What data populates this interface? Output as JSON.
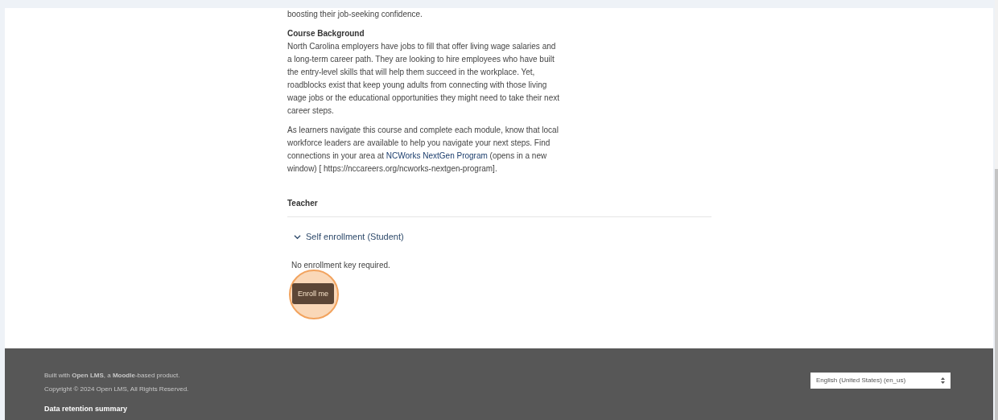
{
  "intro_tail": "boosting their job-seeking confidence.",
  "background": {
    "heading": "Course Background",
    "text": "North Carolina employers have jobs to fill that offer living wage salaries and a long-term career path. They are looking to hire employees who have built the entry-level skills that will help them succeed in the workplace. Yet, roadblocks exist that keep young adults from connecting with those living wage jobs or the educational opportunities they might need to take their next career steps."
  },
  "navigate": {
    "before": "As learners navigate this course and complete each module, know that local workforce leaders are available to help you navigate your next steps. Find connections in your area at",
    "link": "NCWorks NextGen Program",
    "after": "(opens in a new window) [ https://nccareers.org/ncworks-nextgen-program]."
  },
  "teacher_heading": "Teacher",
  "enrollment": {
    "title": "Self enrollment (Student)",
    "expanded": true,
    "note": "No enrollment key required.",
    "button": "Enroll me"
  },
  "footer": {
    "built_with": "Built with **Open LMS**, a **Moodle**-based product.",
    "copyright": "Copyright © 2024 Open LMS, All Rights Reserved.",
    "data_retention": "Data retention summary",
    "language": "English (United States) (en_us)"
  }
}
